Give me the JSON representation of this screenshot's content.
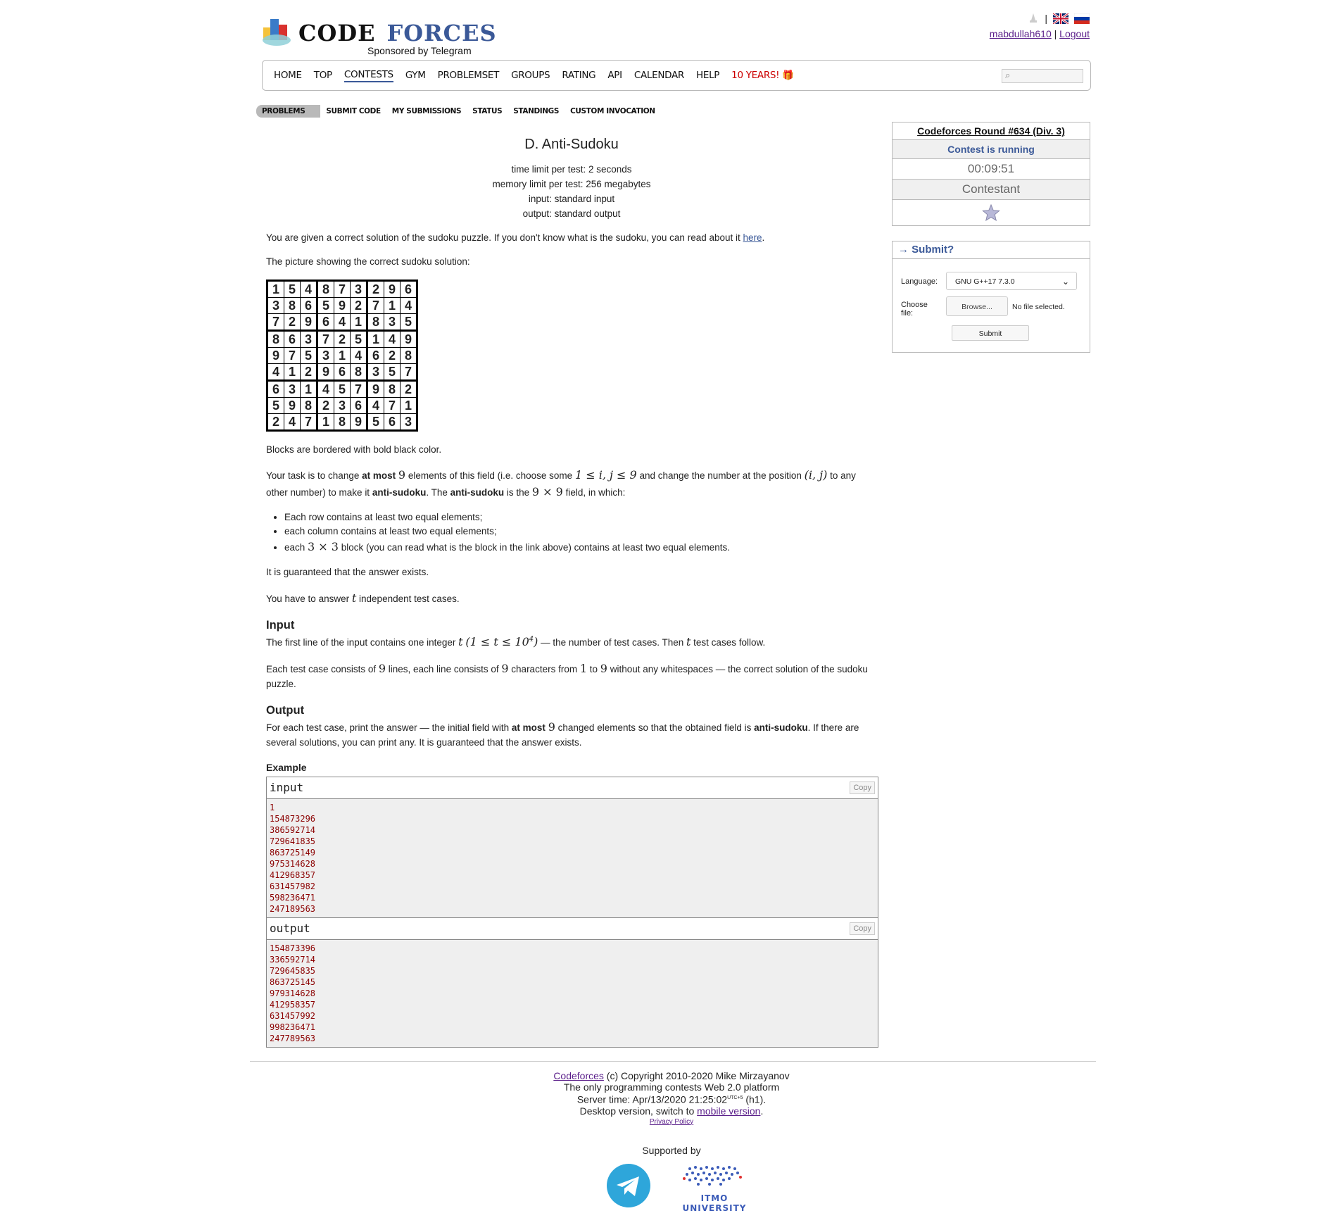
{
  "header": {
    "logo_text_1": "CODE",
    "logo_text_2": "FORCES",
    "sponsor": "Sponsored by Telegram",
    "username": "mabdullah610",
    "separator": "|",
    "logout": "Logout"
  },
  "menu": {
    "items": [
      "HOME",
      "TOP",
      "CONTESTS",
      "GYM",
      "PROBLEMSET",
      "GROUPS",
      "RATING",
      "API",
      "CALENDAR",
      "HELP",
      "10 YEARS!"
    ],
    "active": "CONTESTS"
  },
  "subnav": [
    "PROBLEMS",
    "SUBMIT CODE",
    "MY SUBMISSIONS",
    "STATUS",
    "STANDINGS",
    "CUSTOM INVOCATION"
  ],
  "problem": {
    "title": "D. Anti-Sudoku",
    "time_limit": "time limit per test: 2 seconds",
    "memory_limit": "memory limit per test: 256 megabytes",
    "input": "input: standard input",
    "output": "output: standard output",
    "intro_1": "You are given a correct solution of the sudoku puzzle. If you don't know what is the sudoku, you can read about it ",
    "intro_link": "here",
    "intro_2": "The picture showing the correct sudoku solution:",
    "grid": [
      "154873296",
      "386592714",
      "729641835",
      "863725149",
      "975314628",
      "412968357",
      "631457982",
      "598236471",
      "247189563"
    ],
    "blocks_note": "Blocks are bordered with bold black color.",
    "task_a": "Your task is to change ",
    "task_b": "at most",
    "task_c": " elements of this field (i.e. choose some ",
    "task_d": " and change the number at the position ",
    "task_e": " to any other number) to make it ",
    "task_f": "anti-sudoku",
    "task_g": ". The ",
    "task_h": "anti-sudoku",
    "task_i": " is the ",
    "task_j": " field, in which:",
    "math_9": "9",
    "math_ij": "1 ≤ i, j ≤ 9",
    "math_pos": "(i, j)",
    "math_9x9": "9 × 9",
    "math_3x3": "3 × 3",
    "math_t": "t",
    "math_t_range": "(1 ≤ t ≤ 10",
    "math_exp": "4",
    "math_1": "1",
    "bullet_1": "Each row contains at least two equal elements;",
    "bullet_2": "each column contains at least two equal elements;",
    "bullet_3a": "each ",
    "bullet_3b": " block (you can read what is the block in the link above) contains at least two equal elements.",
    "guaranteed": "It is guaranteed that the answer exists.",
    "answer_a": "You have to answer ",
    "answer_b": " independent test cases.",
    "input_title": "Input",
    "input_a": "The first line of the input contains one integer ",
    "input_b": " — the number of test cases. Then ",
    "input_c": " test cases follow.",
    "input2_a": "Each test case consists of ",
    "input2_b": " lines, each line consists of ",
    "input2_c": " characters from ",
    "input2_d": " to ",
    "input2_e": " without any whitespaces — the correct solution of the sudoku puzzle.",
    "output_title": "Output",
    "output_a": "For each test case, print the answer — the initial field with ",
    "output_b": "at most",
    "output_c": " changed elements so that the obtained field is ",
    "output_d": "anti-sudoku",
    "output_e": ". If there are several solutions, you can print any. It is guaranteed that the answer exists.",
    "example_label": "Example",
    "sample_input_label": "input",
    "sample_output_label": "output",
    "copy": "Copy",
    "sample_input": "1\n154873296\n386592714\n729641835\n863725149\n975314628\n412968357\n631457982\n598236471\n247189563",
    "sample_output": "154873396\n336592714\n729645835\n863725145\n979314628\n412958357\n631457992\n998236471\n247789563"
  },
  "sidebar": {
    "round_name": "Codeforces Round #634 (Div. 3)",
    "status": "Contest is running",
    "timer": "00:09:51",
    "role": "Contestant",
    "submit_title": "→ Submit?",
    "language_label": "Language:",
    "language_value": "GNU G++17 7.3.0",
    "file_label": "Choose file:",
    "browse": "Browse...",
    "no_file": "No file selected.",
    "submit_button": "Submit"
  },
  "footer": {
    "link": "Codeforces",
    "copyright": " (c) Copyright 2010-2020 Mike Mirzayanov",
    "tagline": "The only programming contests Web 2.0 platform",
    "server_time_a": "Server time: Apr/13/2020 21:25:02",
    "server_time_tz": "UTC+5",
    "server_time_b": " (h1).",
    "desktop_a": "Desktop version, switch to ",
    "desktop_link": "mobile version",
    "desktop_b": ".",
    "privacy": "Privacy Policy",
    "supported_by": "Supported by",
    "itmo": "ITMO UNIVERSITY"
  },
  "colors": {
    "brand_blue": "#3b5998",
    "sample_text": "#8b0000",
    "ten_years": "#cc0000"
  }
}
